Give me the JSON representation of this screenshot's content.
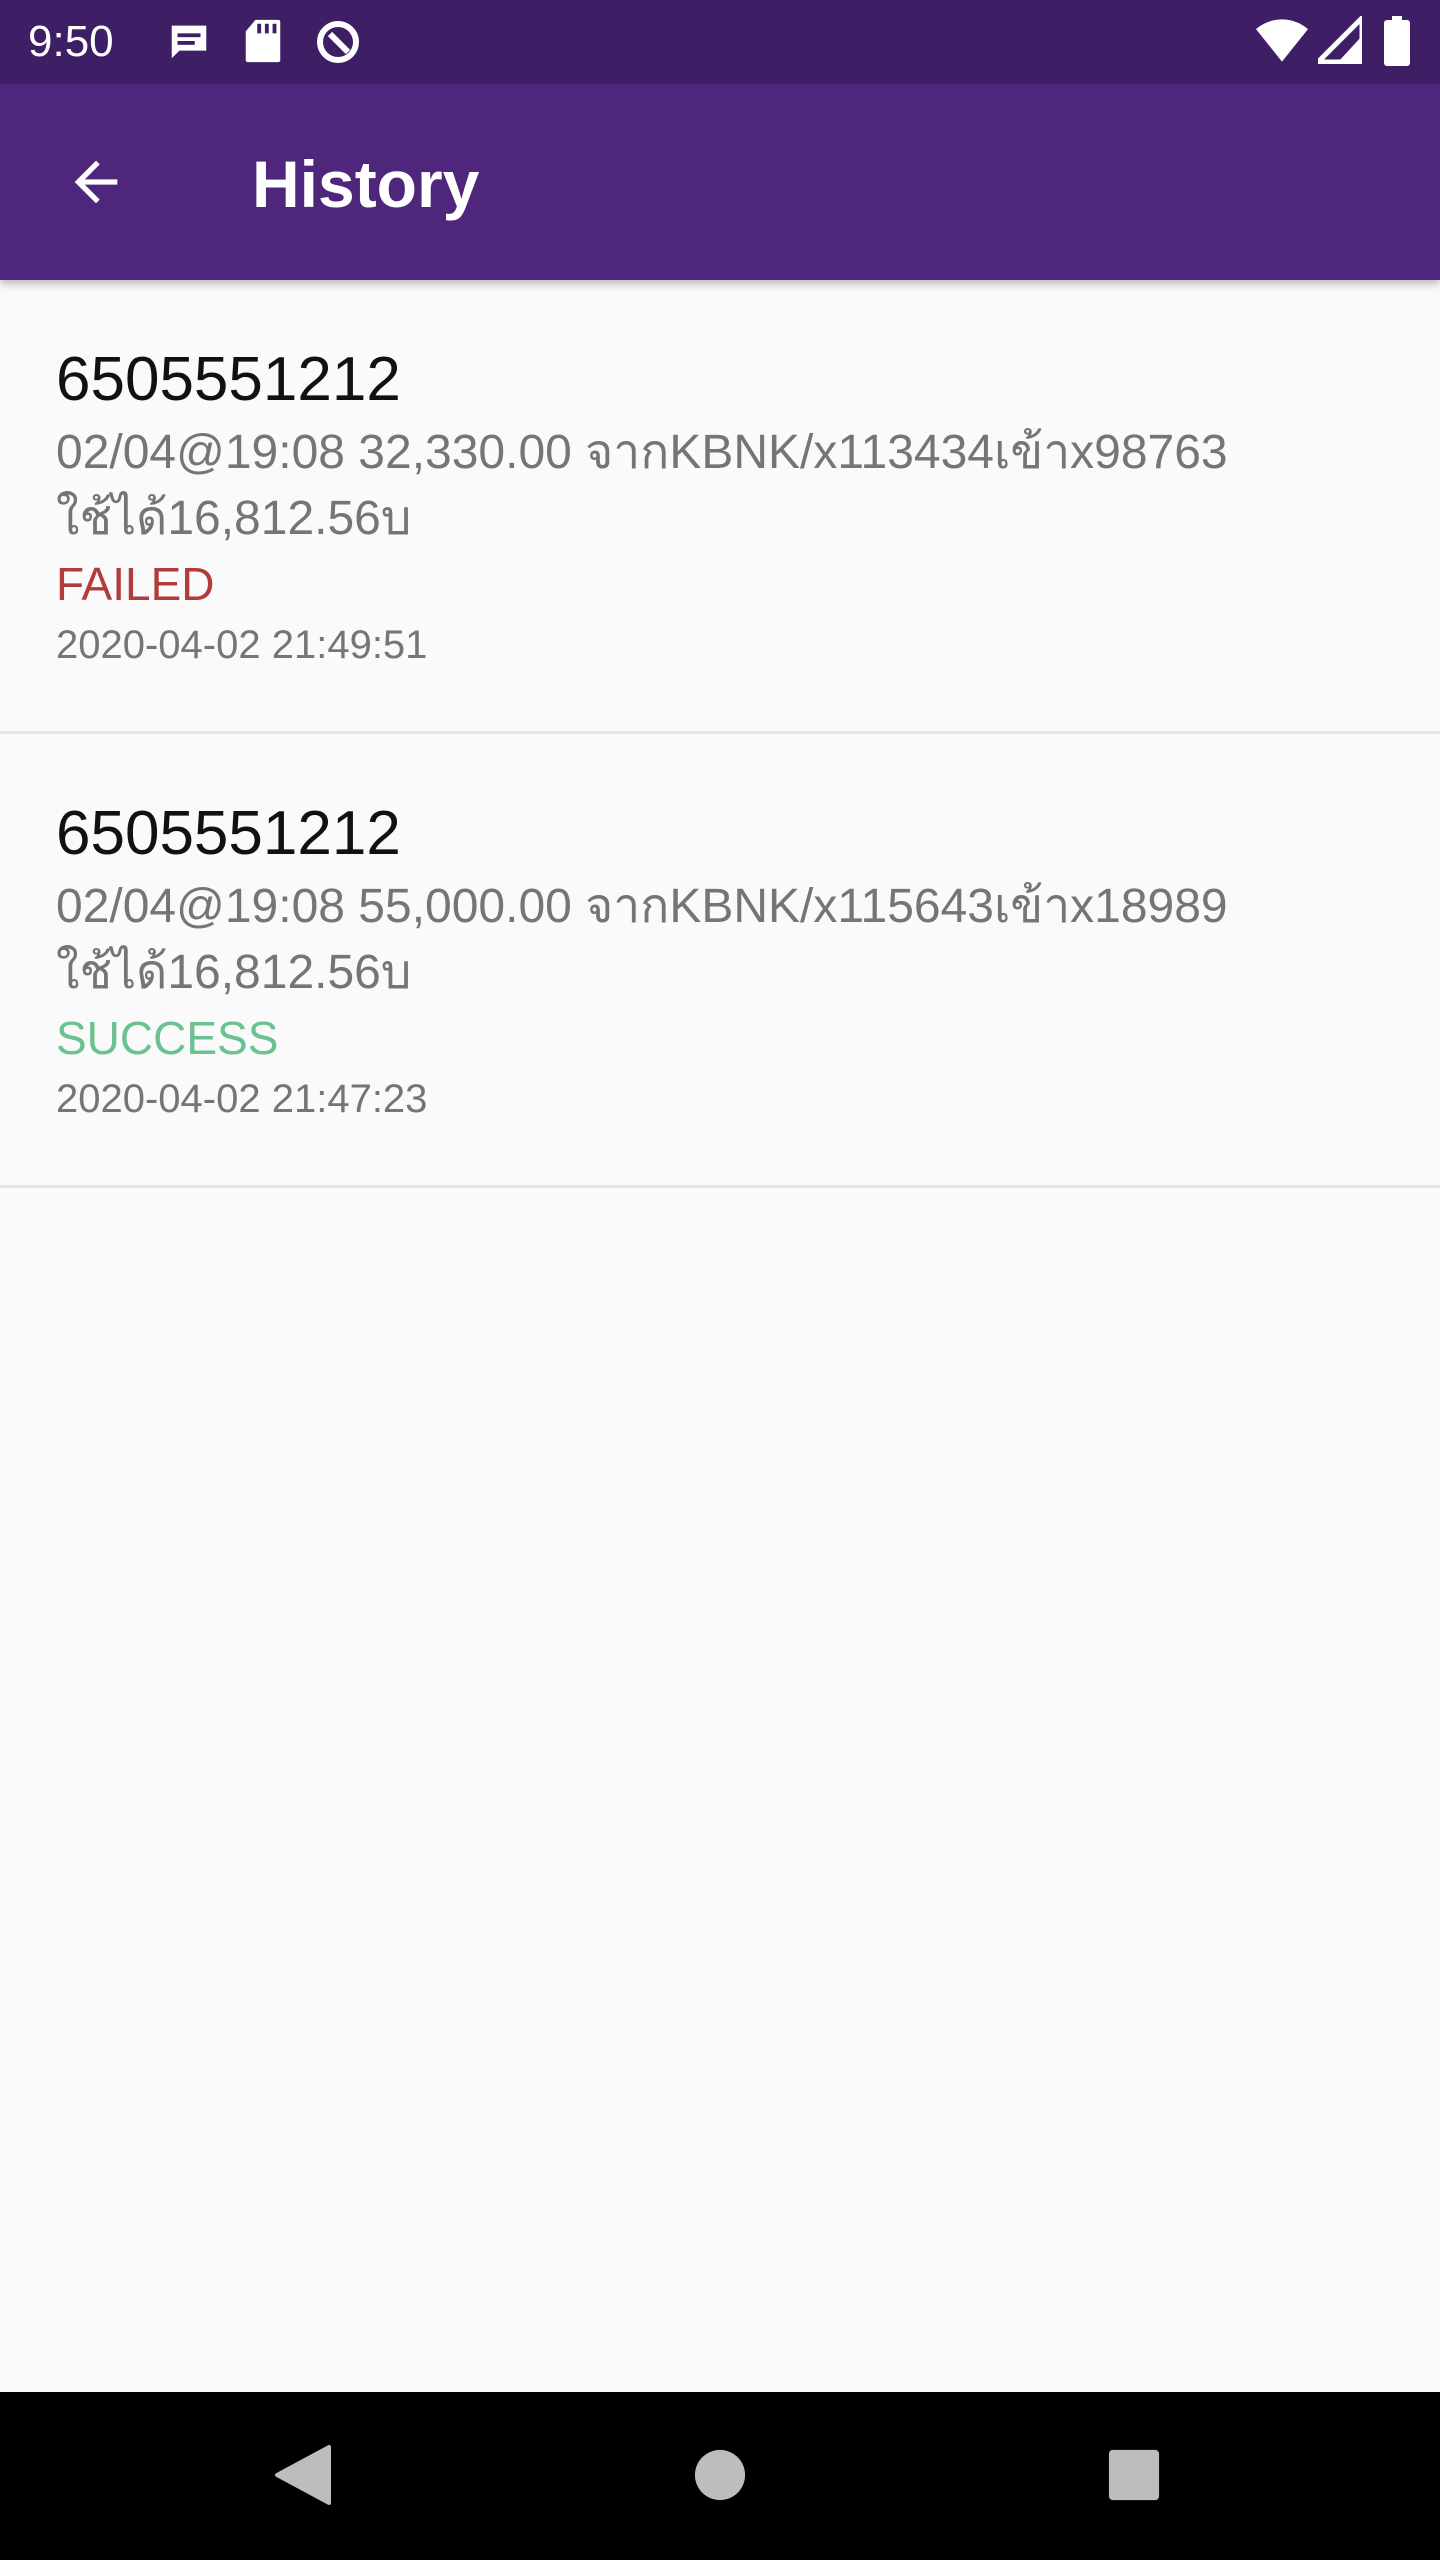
{
  "status_bar": {
    "time": "9:50",
    "left_icons": [
      "message-icon",
      "sd-card-icon",
      "vpn-icon"
    ],
    "right_icons": [
      "wifi-icon",
      "signal-icon",
      "battery-icon"
    ]
  },
  "app_bar": {
    "title": "History",
    "back_icon": "arrow-back-icon",
    "color": "#4e277c"
  },
  "history": {
    "items": [
      {
        "phone": "6505551212",
        "message": "02/04@19:08 32,330.00 จากKBNK/x113434เข้าx98763 ใช้ได้16,812.56บ",
        "status": "FAILED",
        "status_color": "#b23b3b",
        "timestamp": "2020-04-02 21:49:51"
      },
      {
        "phone": "6505551212",
        "message": "02/04@19:08 55,000.00 จากKBNK/x115643เข้าx18989 ใช้ได้16,812.56บ",
        "status": "SUCCESS",
        "status_color": "#6cc191",
        "timestamp": "2020-04-02 21:47:23"
      }
    ]
  },
  "nav_bar": {
    "buttons": [
      "back-triangle-icon",
      "home-circle-icon",
      "recents-square-icon"
    ]
  }
}
